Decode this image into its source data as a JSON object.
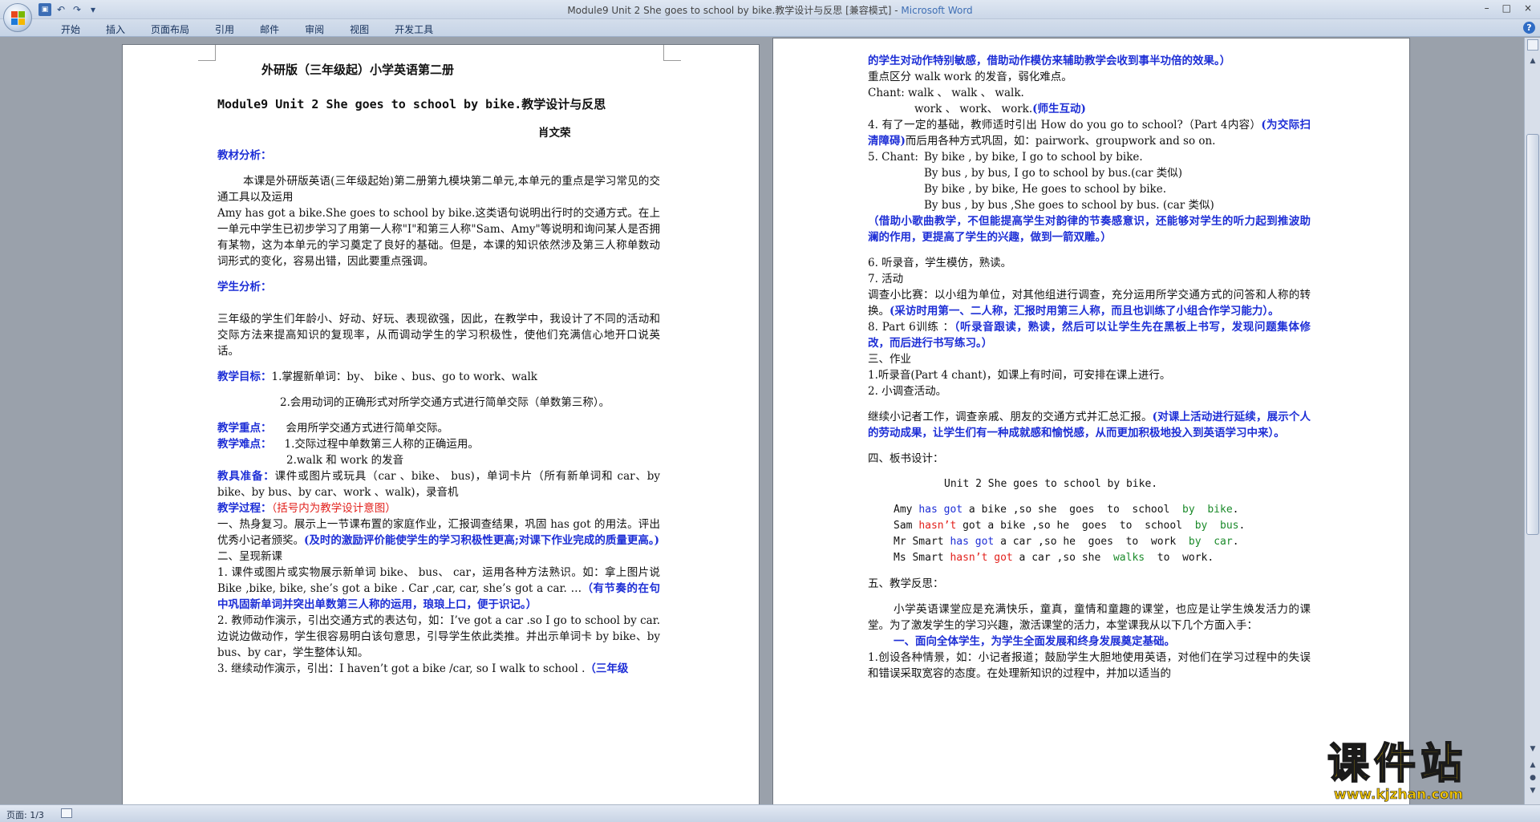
{
  "window": {
    "title": "Module9 Unit 2    She goes to school by bike.教学设计与反思 [兼容模式] - ",
    "app_name": "Microsoft Word",
    "controls": [
      "–",
      "□",
      "×"
    ]
  },
  "quick_access": {
    "icons": [
      "save-icon",
      "undo-icon",
      "redo-icon",
      "customize-icon"
    ],
    "glyphs": [
      "▣",
      "↶",
      "↷",
      "▾"
    ]
  },
  "ribbon": {
    "tabs": [
      "开始",
      "插入",
      "页面布局",
      "引用",
      "邮件",
      "审阅",
      "视图",
      "开发工具"
    ],
    "help": "?"
  },
  "status": {
    "page_info": "页面: 1/3"
  },
  "watermark": {
    "title": "课件站",
    "url": "www.kjzhan.com"
  },
  "left_page": {
    "title": "外研版（三年级起）小学英语第二册",
    "subtitle": "Module9 Unit 2    She goes to school by bike.教学设计与反思",
    "author": "肖文荣",
    "h_textbook": "教材分析：",
    "p_textbook_1": "本课是外研版英语(三年级起始)第二册第九模块第二单元,本单元的重点是学习常见的交通工具以及运用",
    "p_textbook_2": "Amy has got a bike.She goes to school by bike.这类语句说明出行时的交通方式。在上一单元中学生已初步学习了用第一人称\"I\"和第三人称\"Sam、Amy\"等说明和询问某人是否拥有某物，这为本单元的学习奠定了良好的基础。但是，本课的知识依然涉及第三人称单数动词形式的变化，容易出错，因此要重点强调。",
    "h_students": "学生分析：",
    "p_students": "三年级的学生们年龄小、好动、好玩、表现欲强，因此，在教学中，我设计了不同的活动和交际方法来提高知识的复现率，从而调动学生的学习积极性，使他们充满信心地开口说英话。",
    "h_goals": "教学目标：",
    "goal_1": "1.掌握新单词：by、 bike 、bus、go to work、walk",
    "goal_2": "2.会用动词的正确形式对所学交通方式进行简单交际（单数第三称）。",
    "h_key": "教学重点：",
    "key_text": "会用所学交通方式进行简单交际。",
    "h_diff": "教学难点：",
    "diff_1": "1.交际过程中单数第三人称的正确运用。",
    "diff_2": "2.walk 和 work 的发音",
    "h_aids": "教具准备：",
    "aids_text": "课件或图片或玩具（car 、bike、 bus)，单词卡片（所有新单词和 car、by bike、by bus、by car、work 、walk)，录音机",
    "h_process": "教学过程：",
    "process_note": "（括号内为教学设计意图）",
    "warm_title": "一、热身复习。",
    "warm_text": "展示上一节课布置的家庭作业，汇报调查结果，巩固 has got 的用法。评出优秀小记者颁奖。",
    "warm_note": "(及时的激励评价能使学生的学习积极性更高;对课下作业完成的质量更高。)",
    "present_title": "二、呈现新课",
    "step1_text": "1. 课件或图片或实物展示新单词 bike、 bus、 car，运用各种方法熟识。如：拿上图片说 Bike ,bike, bike, she’s got a bike .  Car ,car, car, she’s got a car. …",
    "step1_note": "（有节奏的在句中巩固新单词并突出单数第三人称的运用，琅琅上口，便于识记。）",
    "step2_text": "2. 教师动作演示，引出交通方式的表达句，如：I’ve got a car .so  I go to school by car.边说边做动作，学生很容易明白该句意思，引导学生依此类推。并出示单词卡 by bike、by bus、by car，学生整体认知。",
    "step3_text": "3. 继续动作演示，引出：I  haven’t got a bike /car, so I walk to school .",
    "step3_note": "（三年级"
  },
  "right_page": {
    "carry_note": "的学生对动作特别敏感，借助动作模仿来辅助教学会收到事半功倍的效果。）",
    "distinguish": "重点区分 walk  work 的发音，弱化难点。",
    "chant1_a": "Chant:    walk 、 walk 、 walk.",
    "chant1_b": "work 、 work、  work.",
    "chant1_note": "(师生互动)",
    "step4_text": "4. 有了一定的基础，教师适时引出 How do you go to school?（Part 4内容）",
    "step4_note": "(为交际扫清障碍)",
    "step4_tail": "而后用各种方式巩固，如：pairwork、groupwork and so on.",
    "chant2_label": "5. Chant:",
    "chant2_lines": [
      "By bike  ,    by bike, I go to school by bike.",
      "By bus  ,    by bus, I   go to school by bus.(car 类似)",
      "By bike , by bike,  He goes to school by bike.",
      "By bus  ,   by bus ,She goes to school by bus. (car 类似)"
    ],
    "chant2_note": "（借助小歌曲教学，不但能提高学生对韵律的节奏感意识，还能够对学生的听力起到推波助澜的作用，更提高了学生的兴趣，做到一箭双雕。）",
    "step6": "6. 听录音，学生模仿，熟读。",
    "step7": "7. 活动",
    "survey_text": "调查小比赛：以小组为单位，对其他组进行调查，充分运用所学交通方式的问答和人称的转换。",
    "survey_note": "(采访时用第一、二人称，汇报时用第三人称，而且也训练了小组合作学习能力）。",
    "step8_text": "8. Part 6训练 ：",
    "step8_note": "（听录音跟读，熟读，然后可以让学生先在黑板上书写，发现问题集体修改，而后进行书写练习。）",
    "hw_title": "三、作业",
    "hw_1": "1.听录音(Part 4 chant)，如课上有时间，可安排在课上进行。",
    "hw_2": "2. 小调查活动。",
    "hw_text": "继续小记者工作，调查亲戚、朋友的交通方式并汇总汇报。",
    "hw_note": "(对课上活动进行延续，展示个人的劳动成果，让学生们有一种成就感和愉悦感，从而更加积极地投入到英语学习中来）。",
    "board_title": "四、板书设计：",
    "board_heading": "Unit  2      She  goes  to  school  by  bike.",
    "board_rows": [
      {
        "a": "Amy ",
        "b": "has got",
        "c": " a bike ,so she  goes  to  school  ",
        "d": "by  bike",
        "e": ".",
        "bc": "blue",
        "dc": "green"
      },
      {
        "a": "Sam ",
        "b": "hasn’t",
        "c": " got a bike ,so he  goes  to  school  ",
        "d": "by  bus",
        "e": ".",
        "bc": "red",
        "dc": "green"
      },
      {
        "a": "Mr Smart ",
        "b": "has got",
        "c": " a car ,so he  goes  to  work  ",
        "d": "by  car",
        "e": ".",
        "bc": "blue",
        "dc": "green"
      },
      {
        "a": "Ms Smart ",
        "b": "hasn’t got",
        "c": " a car ,so she  ",
        "d": "walks",
        "e": "  to  work.",
        "bc": "red",
        "dc": "green"
      }
    ],
    "reflect_title": "五、教学反思：",
    "reflect_text": "小学英语课堂应是充满快乐，童真，童情和童趣的课堂，也应是让学生焕发活力的课堂。为了激发学生的学习兴趣，激活课堂的活力，本堂课我从以下几个方面入手：",
    "reflect_1": "一、面向全体学生，为学生全面发展和终身发展奠定基础。",
    "reflect_1_text": "1.创设各种情景，如：小记者报道；鼓励学生大胆地使用英语，对他们在学习过程中的失误和错误采取宽容的态度。在处理新知识的过程中，并加以适当的"
  }
}
